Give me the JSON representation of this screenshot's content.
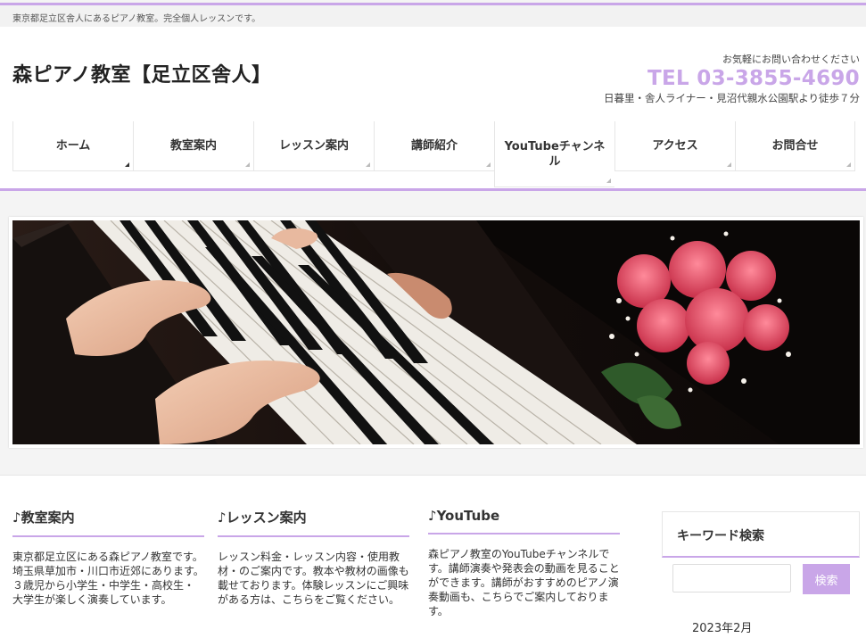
{
  "topbar": {
    "tagline": "東京都足立区舎人にあるピアノ教室。完全個人レッスンです。"
  },
  "header": {
    "site_title": "森ピアノ教室【足立区舎人】",
    "contact_label": "お気軽にお問い合わせください",
    "tel": "TEL 03-3855-4690",
    "access": "日暮里・舎人ライナー・見沼代親水公園駅より徒歩７分"
  },
  "nav": {
    "items": [
      {
        "label": "ホーム"
      },
      {
        "label": "教室案内"
      },
      {
        "label": "レッスン案内"
      },
      {
        "label": "講師紹介"
      },
      {
        "label": "YouTubeチャンネル"
      },
      {
        "label": "アクセス"
      },
      {
        "label": "お問合せ"
      }
    ]
  },
  "columns": [
    {
      "title": "♪教室案内",
      "text": "東京都足立区にある森ピアノ教室です。埼玉県草加市・川口市近郊にあります。３歳児から小学生・中学生・高校生・大学生が楽しく演奏しています。"
    },
    {
      "title": "♪レッスン案内",
      "text": "レッスン料金・レッスン内容・使用教材・のご案内です。教本や教材の画像も載せております。体験レッスンにご興味がある方は、こちらをご覧ください。"
    },
    {
      "title": "♪YouTube",
      "text": "森ピアノ教室のYouTubeチャンネルです。講師演奏や発表会の動画を見ることができます。講師がおすすめのピアノ演奏動画も、こちらでご案内しております。"
    }
  ],
  "sidebar": {
    "search_title": "キーワード検索",
    "search_placeholder": "",
    "search_button": "検索",
    "archive_date": "2023年2月"
  },
  "colors": {
    "accent": "#c9a6e8"
  }
}
